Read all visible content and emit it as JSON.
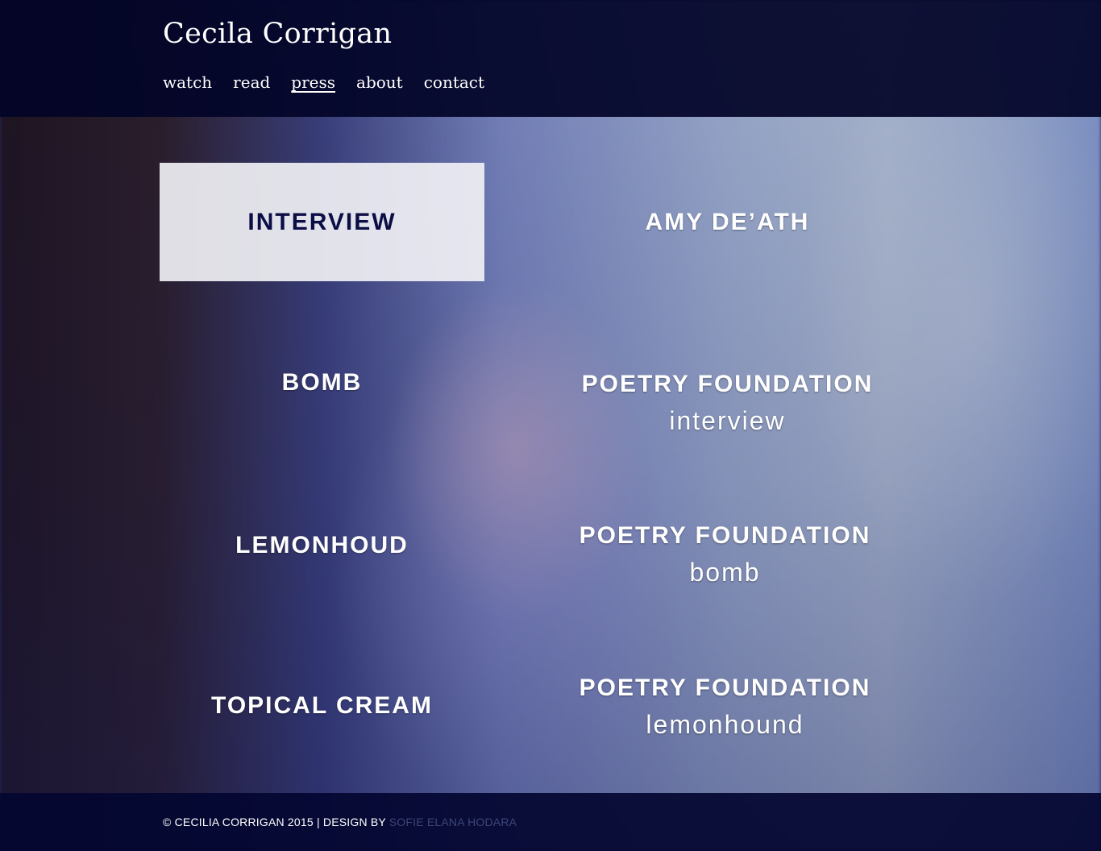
{
  "site": {
    "title": "Cecila Corrigan"
  },
  "nav": {
    "items": [
      {
        "label": "watch"
      },
      {
        "label": "read"
      },
      {
        "label": "press"
      },
      {
        "label": "about"
      },
      {
        "label": "contact"
      }
    ],
    "active": "press"
  },
  "press": {
    "items": [
      {
        "title": "INTERVIEW",
        "subtitle": ""
      },
      {
        "title": "AMY DE’ATH",
        "subtitle": ""
      },
      {
        "title": "BOMB",
        "subtitle": ""
      },
      {
        "title": "POETRY FOUNDATION",
        "subtitle": "interview"
      },
      {
        "title": "LEMONHOUD",
        "subtitle": ""
      },
      {
        "title": "POETRY FOUNDATION",
        "subtitle": "bomb"
      },
      {
        "title": "TOPICAL CREAM",
        "subtitle": ""
      },
      {
        "title": "POETRY FOUNDATION",
        "subtitle": "lemonhound"
      }
    ]
  },
  "footer": {
    "copyright": "© CECILIA CORRIGAN 2015 | DESIGN BY ",
    "designer": "SOFIE ELANA HODARA"
  },
  "colors": {
    "header_bg": "#02042a",
    "highlight_bg": "#f0f0f4",
    "highlight_text": "#0b0d45",
    "designer_link": "#3d4577"
  }
}
